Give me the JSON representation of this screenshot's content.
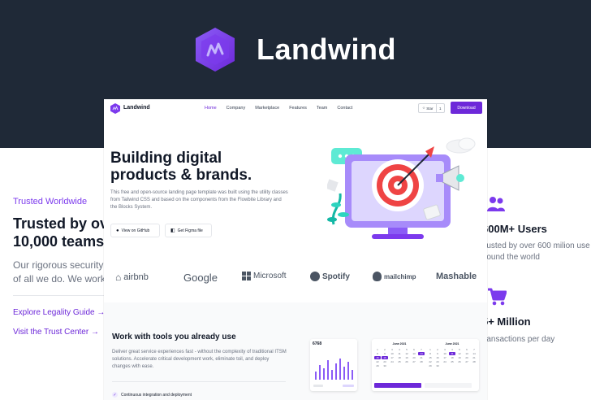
{
  "banner": {
    "brand_name": "Landwind",
    "colors": {
      "background": "#1f2937",
      "logo": "#7c3aed"
    }
  },
  "background_page": {
    "left": {
      "eyebrow": "Trusted Worldwide",
      "heading_line1": "Trusted by ov",
      "heading_line2": "10,000 teams",
      "para_line1": "Our rigorous security a",
      "para_line2": "of all we do. We work t",
      "link1": "Explore Legality Guide →",
      "link2": "Visit the Trust Center →"
    },
    "right": {
      "stat1_title": "600M+ Users",
      "stat1_desc_line1": "rusted by over 600 milion use",
      "stat1_desc_line2": "round the world",
      "stat1_icon": "users-icon",
      "stat2_title": "5+ Million",
      "stat2_desc": "ransactions per day",
      "stat2_icon": "cart-icon"
    }
  },
  "window": {
    "nav": {
      "brand": "Landwind",
      "links": [
        "Home",
        "Company",
        "Marketplace",
        "Features",
        "Team",
        "Contact"
      ],
      "active": "Home",
      "star_label": "Star",
      "star_count": "1",
      "download_label": "Download"
    },
    "hero": {
      "title_line1": "Building digital",
      "title_line2": "products & brands.",
      "description": "This free and open-source landing page template was built using the utility classes from Tailwind CSS and based on the components from the Flowbite Library and the Blocks System.",
      "github_button": "View on GitHub",
      "figma_button": "Get Figma file"
    },
    "logos": [
      "airbnb",
      "Google",
      "Microsoft",
      "Spotify",
      "mailchimp",
      "Mashable"
    ],
    "tools": {
      "title": "Work with tools you already use",
      "description": "Deliver great service experiences fast - without the complexity of traditional ITSM solutions. Accelerate critical development work, eliminate toil, and deploy changes with ease.",
      "check_item": "Continuous integration and deployment",
      "chart_card_value": "6768",
      "calendar_left_month": "June 2021",
      "calendar_right_month": "June 2021",
      "calendar_days": [
        "1",
        "2",
        "3",
        "4",
        "5",
        "6",
        "7",
        "8",
        "9",
        "10",
        "11",
        "12",
        "13",
        "14",
        "15",
        "16",
        "17",
        "18",
        "19",
        "20",
        "21",
        "22",
        "23",
        "24",
        "25",
        "26",
        "27",
        "28",
        "29",
        "30"
      ],
      "accent": "#6d28d9"
    }
  }
}
